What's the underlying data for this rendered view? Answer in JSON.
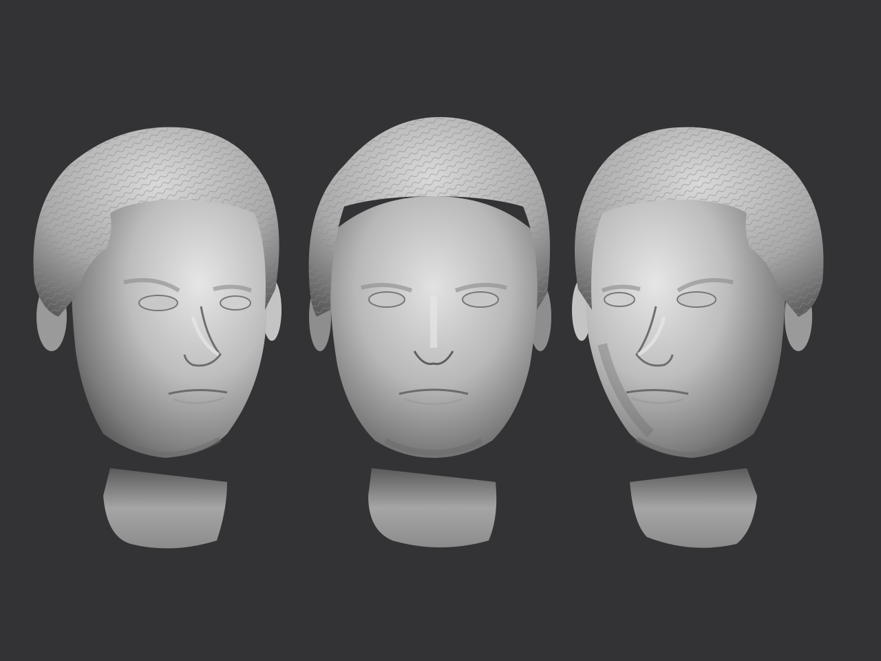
{
  "scene": {
    "background_color": "#333335",
    "material_color": "#bdbdbd",
    "description_kind": "three sculpted clay head renders",
    "views": [
      {
        "id": "three-quarter-left",
        "light": "right"
      },
      {
        "id": "front",
        "light": "top"
      },
      {
        "id": "three-quarter-right",
        "light": "left"
      }
    ]
  }
}
